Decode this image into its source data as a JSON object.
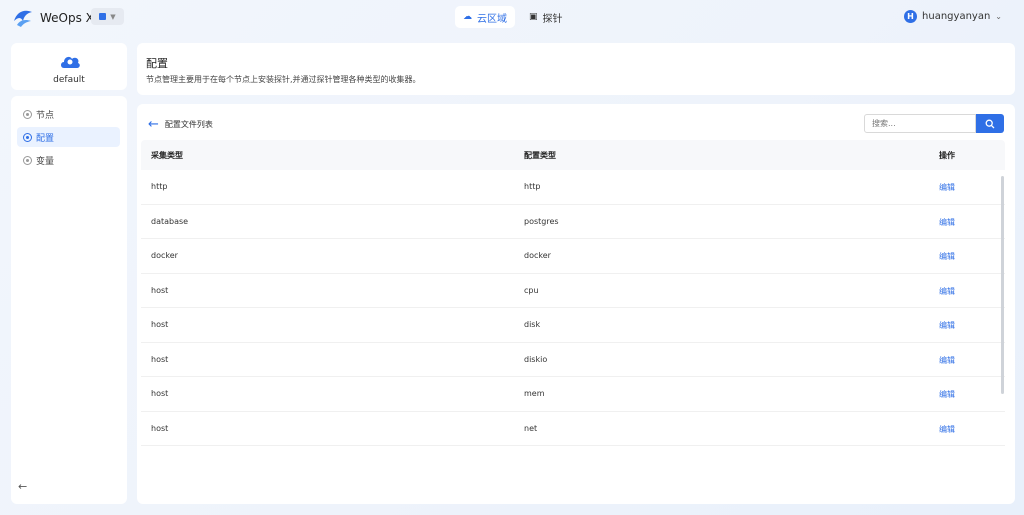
{
  "app": {
    "name": "WeOps X"
  },
  "nav": {
    "tabs": [
      {
        "label": "云区域",
        "active": true
      },
      {
        "label": "探针",
        "active": false
      }
    ]
  },
  "user": {
    "initial": "H",
    "name": "huangyanyan"
  },
  "sidebar": {
    "cloud_name": "default",
    "items": [
      {
        "label": "节点"
      },
      {
        "label": "配置",
        "active": true
      },
      {
        "label": "变量"
      }
    ]
  },
  "header": {
    "title": "配置",
    "description": "节点管理主要用于在每个节点上安装探针,并通过探针管理各种类型的收集器。"
  },
  "main": {
    "back_label": "配置文件列表",
    "search_placeholder": "搜索...",
    "columns": [
      "采集类型",
      "配置类型",
      "操作"
    ],
    "rows": [
      {
        "collect": "http",
        "config": "http",
        "action": "编辑"
      },
      {
        "collect": "database",
        "config": "postgres",
        "action": "编辑"
      },
      {
        "collect": "docker",
        "config": "docker",
        "action": "编辑"
      },
      {
        "collect": "host",
        "config": "cpu",
        "action": "编辑"
      },
      {
        "collect": "host",
        "config": "disk",
        "action": "编辑"
      },
      {
        "collect": "host",
        "config": "diskio",
        "action": "编辑"
      },
      {
        "collect": "host",
        "config": "mem",
        "action": "编辑"
      },
      {
        "collect": "host",
        "config": "net",
        "action": "编辑"
      }
    ]
  },
  "colors": {
    "accent": "#2f6fe6"
  }
}
